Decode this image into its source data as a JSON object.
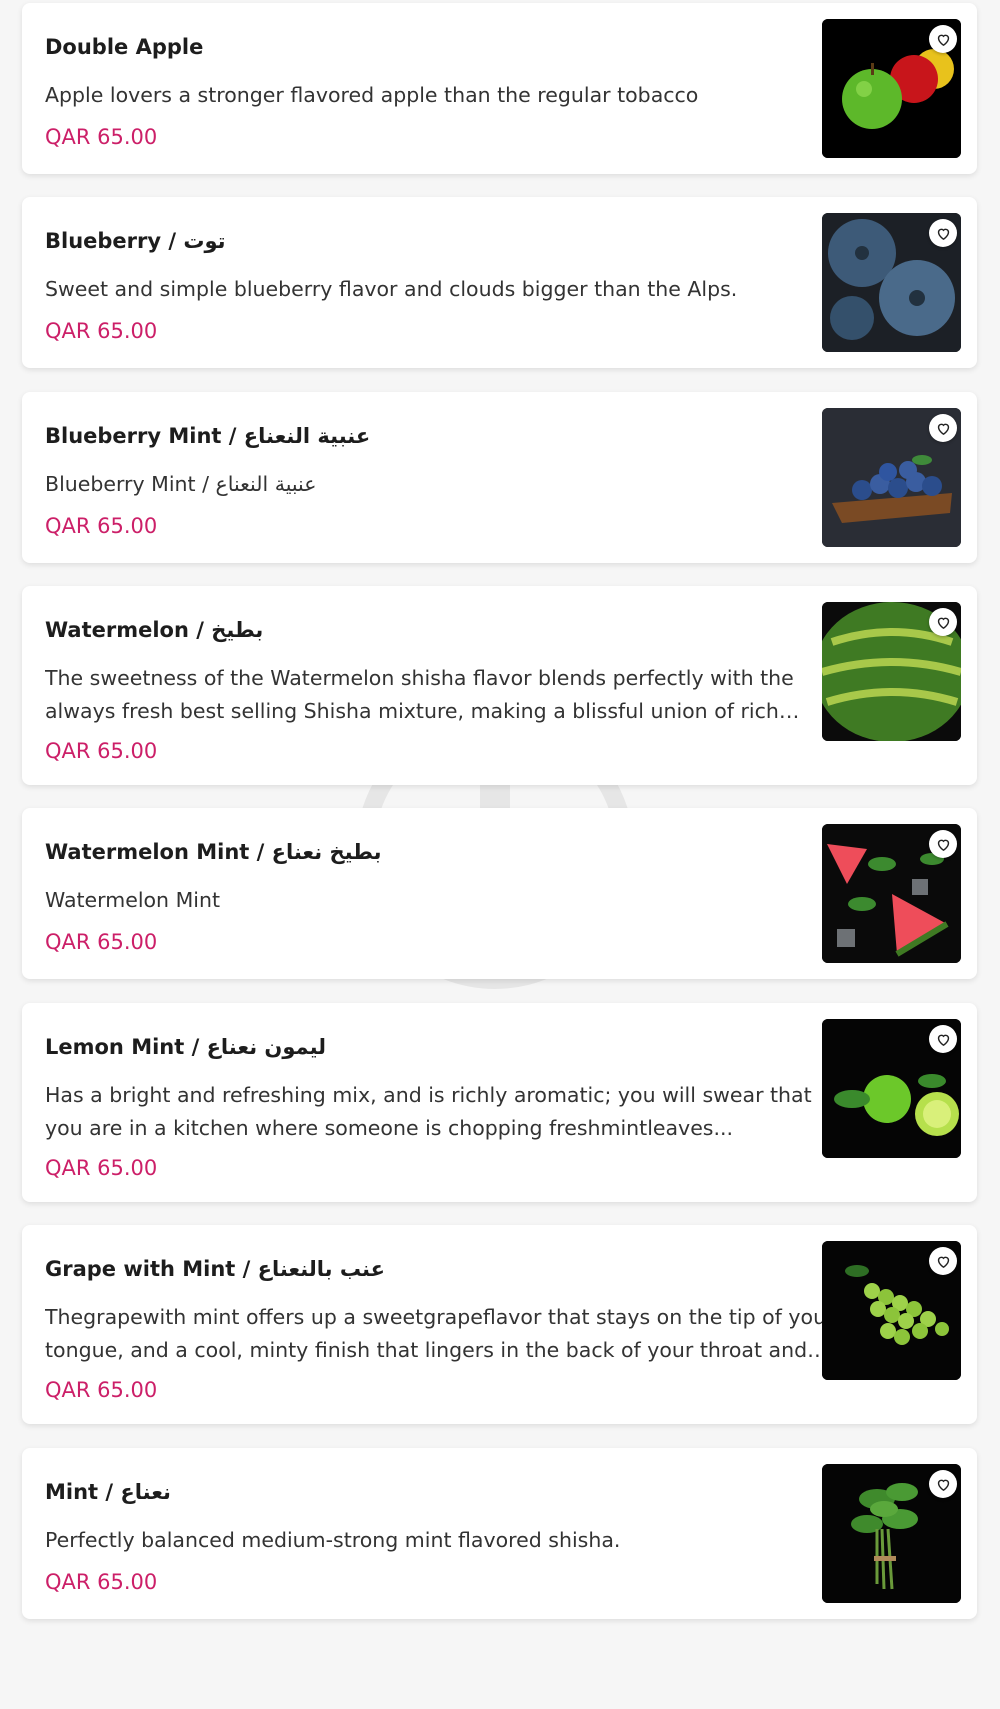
{
  "colors": {
    "price": "#cc1f68",
    "card_bg": "#ffffff",
    "page_bg": "#f6f6f6"
  },
  "items": [
    {
      "name": "Double Apple",
      "description": "Apple lovers a stronger flavored apple than the regular tobacco",
      "price": "QAR 65.00",
      "image": "apples-image",
      "favorite_icon": "heart-outline-icon"
    },
    {
      "name": "Blueberry / توت",
      "description": "Sweet and simple blueberry flavor and clouds bigger than the Alps.",
      "price": "QAR 65.00",
      "image": "blueberries-closeup-image",
      "favorite_icon": "heart-outline-icon"
    },
    {
      "name": "Blueberry Mint / عنبية النعناع",
      "description": "Blueberry Mint / عنبية النعناع",
      "price": "QAR 65.00",
      "image": "blueberries-bowl-image",
      "favorite_icon": "heart-outline-icon"
    },
    {
      "name": "Watermelon / بطيخ",
      "description": "The sweetness of the Watermelon shisha flavor blends perfectly with the always fresh best selling Shisha mixture, making a blissful union of rich and...",
      "price": "QAR 65.00",
      "image": "watermelon-image",
      "favorite_icon": "heart-outline-icon"
    },
    {
      "name": "Watermelon Mint / بطيخ نعناع",
      "description": "Watermelon Mint",
      "price": "QAR 65.00",
      "image": "watermelon-slices-mint-image",
      "favorite_icon": "heart-outline-icon"
    },
    {
      "name": "Lemon Mint / ليمون نعناع",
      "description": "Has a bright and refreshing mix, and is richly aromatic; you will swear that you are in a kitchen where someone is chopping freshmintleaves...",
      "price": "QAR 65.00",
      "image": "limes-mint-image",
      "favorite_icon": "heart-outline-icon"
    },
    {
      "name": "Grape with Mint / عنب بالنعناع",
      "description": "Thegrapewith mint offers up a sweetgrapeflavor that stays on the tip of your tongue, and a cool, minty finish that lingers in the back of your throat and o...",
      "price": "QAR 65.00",
      "image": "green-grapes-image",
      "favorite_icon": "heart-outline-icon"
    },
    {
      "name": "Mint / نعناع",
      "description": "Perfectly balanced medium-strong mint flavored shisha.",
      "price": "QAR 65.00",
      "image": "mint-bunch-image",
      "favorite_icon": "heart-outline-icon"
    }
  ]
}
